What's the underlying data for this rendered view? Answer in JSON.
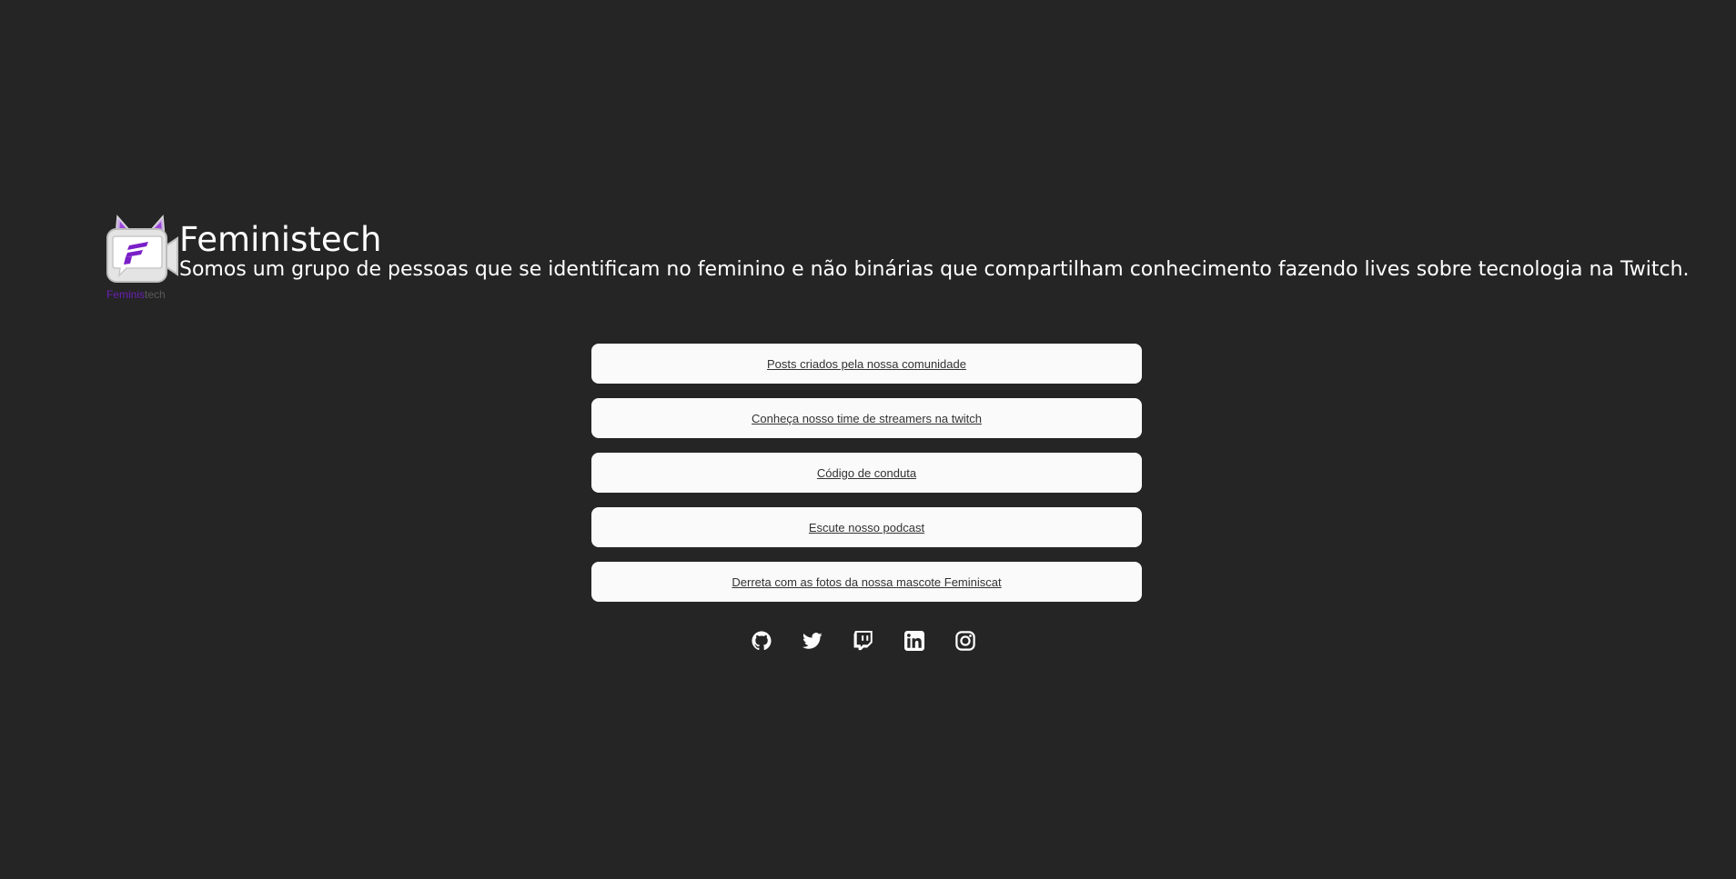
{
  "brand": {
    "title": "Feministech",
    "tagline": "Somos um grupo de pessoas que se identificam no feminino e não binárias que compartilham conhecimento fazendo lives sobre tecnologia na Twitch.",
    "logo_text_part1": "Feminis",
    "logo_text_part2": "tech",
    "logo_icon": "feministech-cat-camera-logo"
  },
  "links": [
    {
      "label": "Posts criados pela nossa comunidade"
    },
    {
      "label": "Conheça nosso time de streamers na twitch"
    },
    {
      "label": "Código de conduta"
    },
    {
      "label": "Escute nosso podcast"
    },
    {
      "label": "Derreta com as fotos da nossa mascote Feminiscat"
    }
  ],
  "socials": [
    {
      "icon": "github-icon"
    },
    {
      "icon": "twitter-icon"
    },
    {
      "icon": "twitch-icon"
    },
    {
      "icon": "linkedin-icon"
    },
    {
      "icon": "instagram-icon"
    }
  ],
  "colors": {
    "background": "#252525",
    "button_bg": "#fafafa",
    "accent_purple": "#6a1fb5",
    "text": "#ffffff"
  }
}
